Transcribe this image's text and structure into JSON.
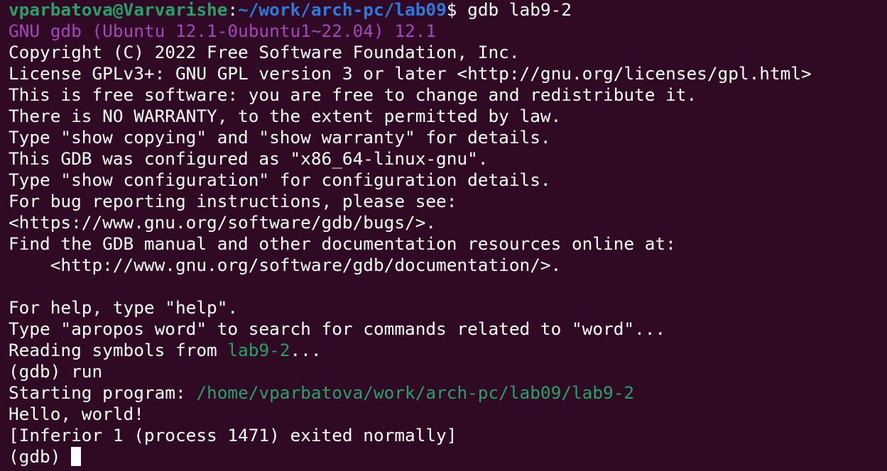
{
  "colors": {
    "background": "#300a24",
    "foreground": "#ffffff",
    "prompt_user": "#26a269",
    "prompt_path": "#2a7bde",
    "gdb_banner": "#a347ba",
    "filename": "#26a269",
    "cursor": "#ffffff"
  },
  "prompt": {
    "user_host": "vparbatova@Varvarishe",
    "separator": ":",
    "path": "~/work/arch-pc/lab09",
    "symbol": "$",
    "command": " gdb lab9-2"
  },
  "gdb": {
    "banner": "GNU gdb (Ubuntu 12.1-0ubuntu1~22.04) 12.1",
    "info_lines": [
      "Copyright (C) 2022 Free Software Foundation, Inc.",
      "License GPLv3+: GNU GPL version 3 or later <http://gnu.org/licenses/gpl.html>",
      "This is free software: you are free to change and redistribute it.",
      "There is NO WARRANTY, to the extent permitted by law.",
      "Type \"show copying\" and \"show warranty\" for details.",
      "This GDB was configured as \"x86_64-linux-gnu\".",
      "Type \"show configuration\" for configuration details.",
      "For bug reporting instructions, please see:",
      "<https://www.gnu.org/software/gdb/bugs/>.",
      "Find the GDB manual and other documentation resources online at:",
      "    <http://www.gnu.org/software/gdb/documentation/>."
    ],
    "help_lines": [
      "For help, type \"help\".",
      "Type \"apropos word\" to search for commands related to \"word\"..."
    ],
    "reading_prefix": "Reading symbols from ",
    "reading_file": "lab9-2",
    "reading_suffix": "...",
    "run_command": "(gdb) run",
    "starting_prefix": "Starting program: ",
    "starting_path": "/home/vparbatova/work/arch-pc/lab09/lab9-2",
    "program_output": "Hello, world!",
    "exit_message": "[Inferior 1 (process 1471) exited normally]",
    "final_prompt": "(gdb) "
  }
}
